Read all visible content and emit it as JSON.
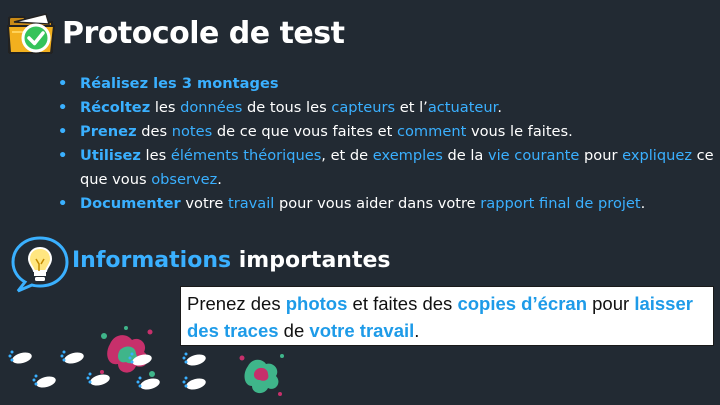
{
  "header": {
    "title": "Protocole de test",
    "icon": "folder-check-icon"
  },
  "steps": [
    {
      "parts": [
        "Réalisez les 3 montages"
      ]
    },
    {
      "parts": [
        "Récoltez",
        " les ",
        "données",
        " de tous les ",
        "capteurs",
        " et l’",
        "actuateur",
        "."
      ]
    },
    {
      "parts": [
        "Prenez",
        " des ",
        "notes",
        " de ce que vous faites et ",
        "comment",
        " vous le faites."
      ]
    },
    {
      "parts": [
        "Utilisez",
        " les ",
        "éléments théoriques",
        ", et de ",
        "exemples",
        " de la ",
        "vie courante",
        " pour ",
        "expliquez",
        " ce que vous ",
        "observez",
        "."
      ]
    },
    {
      "parts": [
        "Documenter",
        " votre ",
        "travail",
        " pour vous aider dans votre ",
        "rapport final de projet",
        "."
      ]
    }
  ],
  "info": {
    "icon": "lightbulb-icon",
    "title_highlight": "Informations",
    "title_rest": " importantes"
  },
  "note": {
    "parts": [
      "Prenez des ",
      "photos",
      " et faites des ",
      "copies d’écran",
      " pour ",
      "laisser des traces",
      " de ",
      "votre travail",
      "."
    ]
  },
  "colors": {
    "accent": "#3ab0ff",
    "background": "#222a33",
    "note_accent": "#1e9be8"
  }
}
